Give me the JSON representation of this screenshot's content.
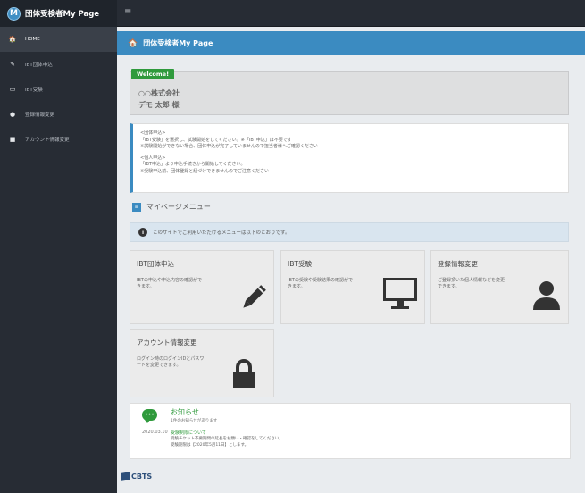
{
  "brand": {
    "logo_letter": "M",
    "title": "団体受検者My Page"
  },
  "topbar": {
    "menu_icon": "≡"
  },
  "sidebar": {
    "items": [
      {
        "label": "HOME",
        "icon": "home-icon",
        "glyph": "🏠"
      },
      {
        "label": "IBT団体申込",
        "icon": "pencil-icon",
        "glyph": "✎"
      },
      {
        "label": "IBT受験",
        "icon": "monitor-icon",
        "glyph": "▭"
      },
      {
        "label": "登録情報変更",
        "icon": "user-icon",
        "glyph": "●"
      },
      {
        "label": "アカウント情報変更",
        "icon": "lock-icon",
        "glyph": "■"
      }
    ]
  },
  "header": {
    "title": "団体受検者My Page",
    "icon_glyph": "🏠"
  },
  "welcome": {
    "tag": "Welcome!",
    "company": "○○株式会社",
    "user": "デモ 太郎 様"
  },
  "notice": {
    "lines": [
      "<団体申込>",
      "「IBT受験」を選択し、試験開始をしてください。※「IBT申込」は不要です",
      "※試験開始ができない場合、団体申込が完了していませんので担当者様へご確認ください",
      "",
      "<個人申込>",
      "「IBT申込」より申込手続きから開始してください。",
      "※受験申込前、団体登録と紐づけできませんのでご注意ください"
    ]
  },
  "mymenu": {
    "title": "マイページメニュー",
    "icon_glyph": "≡"
  },
  "info": {
    "icon_glyph": "i",
    "text": "このサイトでご利用いただけるメニューは以下のとおりです。"
  },
  "cards": [
    {
      "title": "IBT団体申込",
      "desc": [
        "IBTの申込や申込内容の確認がで",
        "きます。"
      ],
      "icon": "pencil-icon"
    },
    {
      "title": "IBT受験",
      "desc": [
        "IBTの受験や受験結果の確認がで",
        "きます。"
      ],
      "icon": "monitor-icon"
    },
    {
      "title": "登録情報変更",
      "desc": [
        "ご登録頂いた個人情報などを変更",
        "できます。"
      ],
      "icon": "user-icon"
    },
    {
      "title": "アカウント情報変更",
      "desc": [
        "ログイン時のログインIDとパスワ",
        "ードを変更できます。"
      ],
      "icon": "lock-icon"
    }
  ],
  "news": {
    "title": "お知らせ",
    "subtitle": "1件のお知らせがあります",
    "date": "2020.03.10",
    "link": "受験制限について",
    "body": [
      "受験チケット不要期間の延長をお願い・確認をしてください。",
      "受験期限は【2020年5月11日】とします。"
    ]
  },
  "footer": {
    "logo_text": "CBTS"
  },
  "colors": {
    "accent": "#3b8bc1",
    "green": "#2f9a3c",
    "sidebar": "#272c34"
  }
}
